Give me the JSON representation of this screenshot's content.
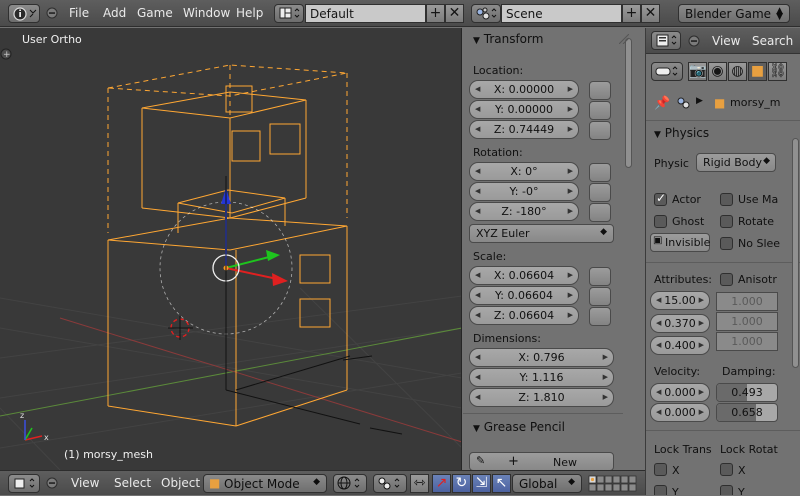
{
  "topbar": {
    "menus": [
      "File",
      "Add",
      "Game",
      "Window",
      "Help"
    ],
    "screen_layout": "Default",
    "scene": "Scene",
    "engine": "Blender Game"
  },
  "viewport": {
    "view_label": "User Ortho",
    "object_label": "(1) morsy_mesh"
  },
  "transform": {
    "title": "Transform",
    "location_label": "Location:",
    "location": [
      "X: 0.00000",
      "Y: 0.00000",
      "Z: 0.74449"
    ],
    "rotation_label": "Rotation:",
    "rotation": [
      "X: 0°",
      "Y: -0°",
      "Z: -180°"
    ],
    "rotation_mode": "XYZ Euler",
    "scale_label": "Scale:",
    "scale": [
      "X: 0.06604",
      "Y: 0.06604",
      "Z: 0.06604"
    ],
    "dimensions_label": "Dimensions:",
    "dimensions": [
      "X: 0.796",
      "Y: 1.116",
      "Z: 1.810"
    ]
  },
  "grease_pencil": {
    "title": "Grease Pencil",
    "new_label": "New"
  },
  "properties": {
    "view_menu": "View",
    "search_menu": "Search",
    "object_name": "morsy_m",
    "physics_title": "Physics",
    "physics_type_label": "Physic",
    "physics_type": "Rigid Body",
    "checks": {
      "actor": "Actor",
      "use_material": "Use Ma",
      "ghost": "Ghost",
      "rotate": "Rotate",
      "invisible": "Invisible",
      "no_sleep": "No Slee"
    },
    "attributes_label": "Attributes:",
    "anisotropic": "Anisotr",
    "attr_values": [
      "15.00",
      "0.370",
      "0.400"
    ],
    "aniso_values": [
      "1.000",
      "1.000",
      "1.000"
    ],
    "velocity_label": "Velocity:",
    "damping_label": "Damping:",
    "velocity": [
      "0.000",
      "0.000"
    ],
    "damping": [
      "0.493",
      "0.658"
    ],
    "damping_fill": [
      0.493,
      0.658
    ],
    "lock_trans": "Lock Trans",
    "lock_rot": "Lock Rotat",
    "lock_x": "X",
    "lock_y": "Y"
  },
  "bottombar": {
    "view": "View",
    "select": "Select",
    "object": "Object",
    "mode": "Object Mode",
    "orientation": "Global"
  },
  "colors": {
    "wire": "#ffa733",
    "header_bg": "#555555",
    "panel_bg": "#727272",
    "viewport_bg": "#393939"
  }
}
